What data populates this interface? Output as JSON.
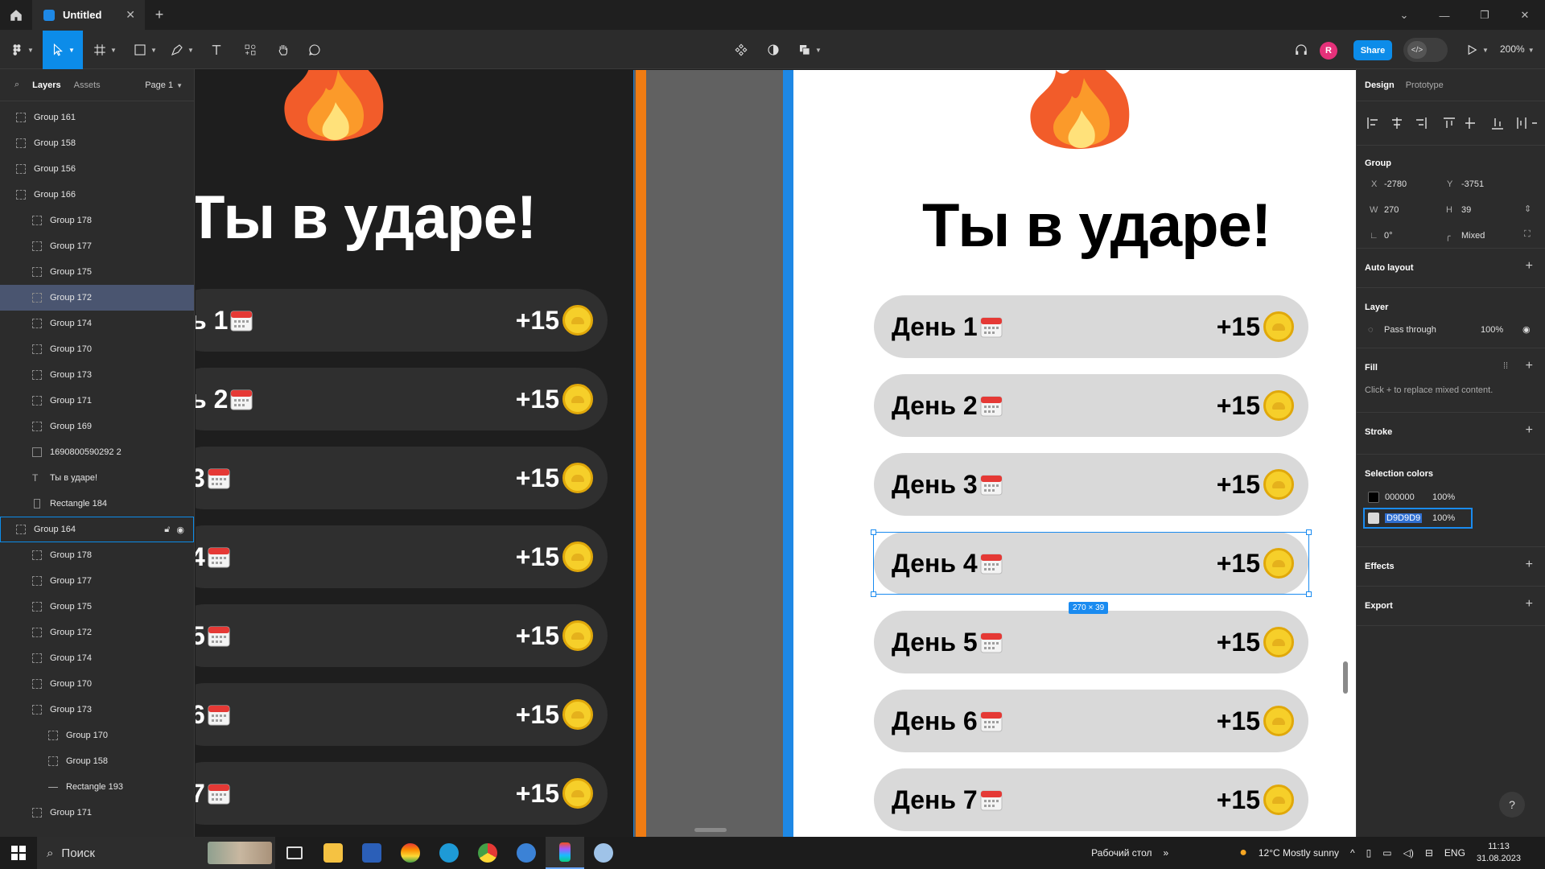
{
  "titlebar": {
    "tab_title": "Untitled",
    "close": "✕",
    "new_tab": "+"
  },
  "toolbar": {
    "share_label": "Share",
    "avatar_letter": "R",
    "zoom": "200%",
    "dev_icon": "</>"
  },
  "left_panel": {
    "tabs": [
      "Layers",
      "Assets"
    ],
    "page": "Page 1",
    "layers": [
      {
        "label": "Group 161",
        "indent": 0,
        "icon": "group"
      },
      {
        "label": "Group 158",
        "indent": 0,
        "icon": "group"
      },
      {
        "label": "Group 156",
        "indent": 0,
        "icon": "group"
      },
      {
        "label": "Group 166",
        "indent": 0,
        "icon": "group"
      },
      {
        "label": "Group 178",
        "indent": 1,
        "icon": "group"
      },
      {
        "label": "Group 177",
        "indent": 1,
        "icon": "group"
      },
      {
        "label": "Group 175",
        "indent": 1,
        "icon": "group"
      },
      {
        "label": "Group 172",
        "indent": 1,
        "icon": "group",
        "selected": true
      },
      {
        "label": "Group 174",
        "indent": 1,
        "icon": "group"
      },
      {
        "label": "Group 170",
        "indent": 1,
        "icon": "group"
      },
      {
        "label": "Group 173",
        "indent": 1,
        "icon": "group"
      },
      {
        "label": "Group 171",
        "indent": 1,
        "icon": "group"
      },
      {
        "label": "Group 169",
        "indent": 1,
        "icon": "group"
      },
      {
        "label": "1690800590292 2",
        "indent": 1,
        "icon": "image"
      },
      {
        "label": "Ты в ударе!",
        "indent": 1,
        "icon": "text"
      },
      {
        "label": "Rectangle 184",
        "indent": 1,
        "icon": "rect"
      },
      {
        "label": "Group 164",
        "indent": 0,
        "icon": "group",
        "outlined": true
      },
      {
        "label": "Group 178",
        "indent": 1,
        "icon": "group"
      },
      {
        "label": "Group 177",
        "indent": 1,
        "icon": "group"
      },
      {
        "label": "Group 175",
        "indent": 1,
        "icon": "group"
      },
      {
        "label": "Group 172",
        "indent": 1,
        "icon": "group"
      },
      {
        "label": "Group 174",
        "indent": 1,
        "icon": "group"
      },
      {
        "label": "Group 170",
        "indent": 1,
        "icon": "group"
      },
      {
        "label": "Group 173",
        "indent": 1,
        "icon": "group"
      },
      {
        "label": "Group 170",
        "indent": 2,
        "icon": "group"
      },
      {
        "label": "Group 158",
        "indent": 2,
        "icon": "group"
      },
      {
        "label": "Rectangle 193",
        "indent": 2,
        "icon": "line"
      },
      {
        "label": "Group 171",
        "indent": 1,
        "icon": "group"
      }
    ]
  },
  "canvas": {
    "headline": "Ты в ударе!",
    "dark_days": [
      "ь 1",
      "ь 2",
      "3",
      "4",
      "5",
      "6",
      "7"
    ],
    "light_days": [
      "День 1",
      "День 2",
      "День 3",
      "День 4",
      "День 5",
      "День 6",
      "День 7"
    ],
    "reward": "+15",
    "selection_size": "270 × 39"
  },
  "right_panel": {
    "tabs": [
      "Design",
      "Prototype"
    ],
    "group_label": "Group",
    "x_label": "X",
    "x_value": "-2780",
    "y_label": "Y",
    "y_value": "-3751",
    "w_label": "W",
    "w_value": "270",
    "h_label": "H",
    "h_value": "39",
    "rotation": "0°",
    "radius": "Mixed",
    "auto_layout": "Auto layout",
    "layer_title": "Layer",
    "blend_mode": "Pass through",
    "layer_opacity": "100%",
    "fill_title": "Fill",
    "fill_hint": "Click + to replace mixed content.",
    "stroke_title": "Stroke",
    "selection_colors_title": "Selection colors",
    "colors": [
      {
        "hex": "000000",
        "opacity": "100%",
        "swatch": "#000000"
      },
      {
        "hex": "D9D9D9",
        "opacity": "100%",
        "swatch": "#D9D9D9"
      }
    ],
    "effects_title": "Effects",
    "export_title": "Export",
    "help": "?"
  },
  "taskbar": {
    "search_placeholder": "Поиск",
    "desktop_label": "Рабочий стол",
    "weather": "12°C  Mostly sunny",
    "lang": "ENG",
    "time": "11:13",
    "date": "31.08.2023"
  }
}
